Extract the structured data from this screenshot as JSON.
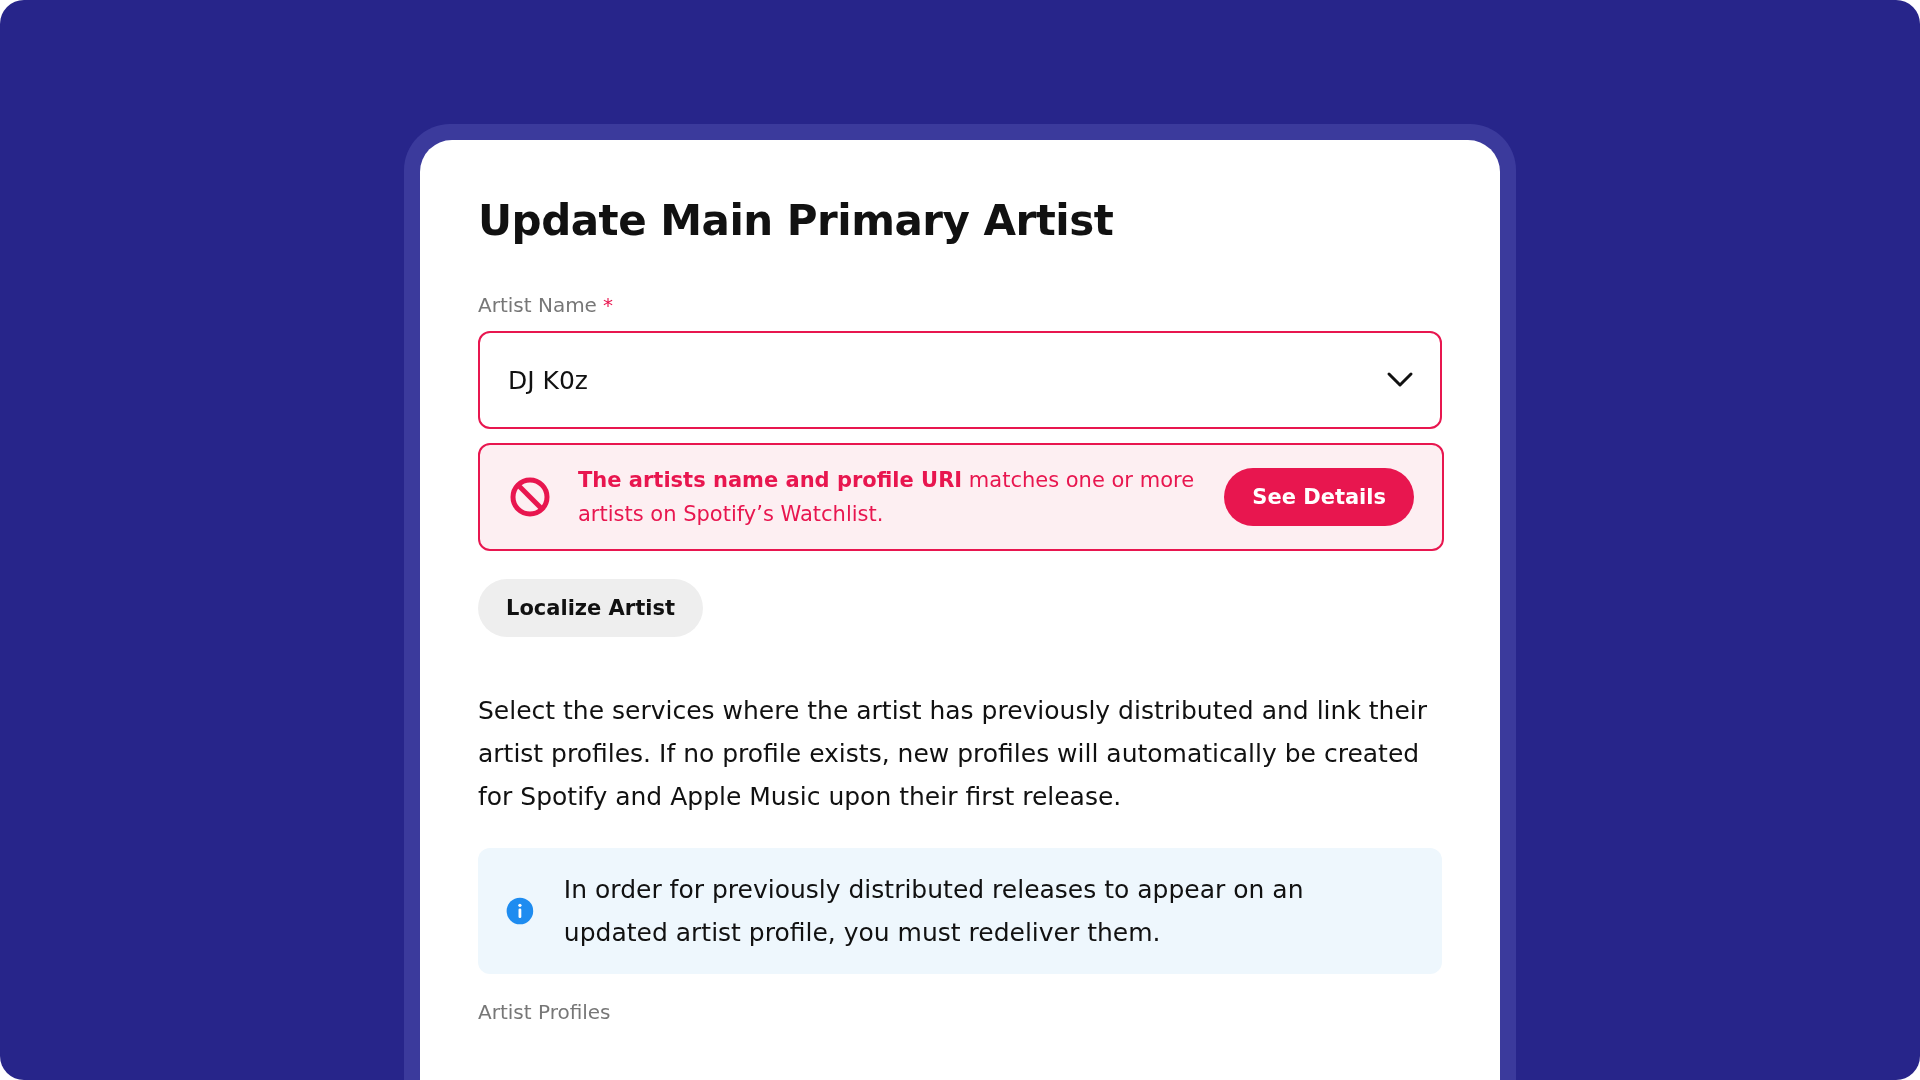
{
  "dialog": {
    "title": "Update Main Primary Artist",
    "artist_field": {
      "label": "Artist Name",
      "required_mark": "*",
      "value": "DJ K0z"
    },
    "alert": {
      "kind": "error",
      "message": "**The artists name and profile URI** matches one or more artists on Spotify’s Watchlist.",
      "button": "See Details"
    },
    "localize_button": "Localize Artist",
    "description": "Select the services where the artist has previously distributed and link their artist profiles. If no profile exists, new profiles will automatically be created for Spotify and Apple Music upon their first release.",
    "info": {
      "kind": "info",
      "message": "In order for previously distributed releases to appear on an updated artist profile, you must redeliver them."
    },
    "profiles_label": "Artist Profiles"
  }
}
